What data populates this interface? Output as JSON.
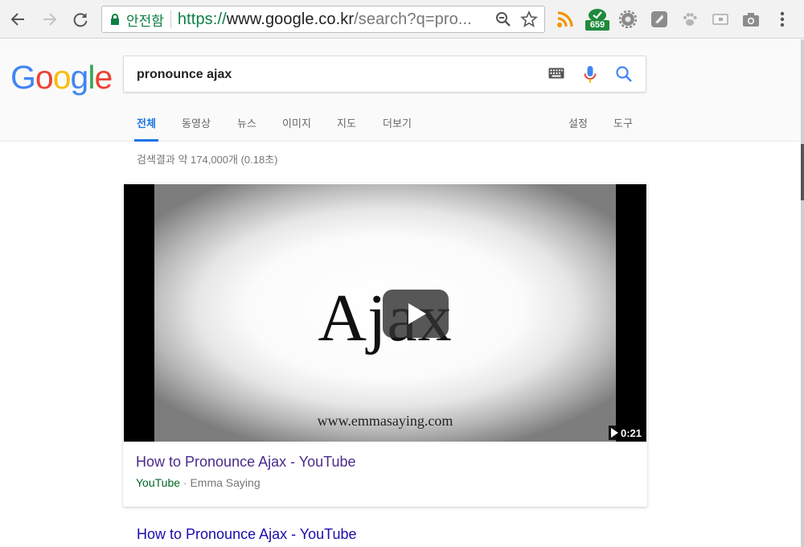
{
  "browser": {
    "security_label": "안전함",
    "url_scheme": "https://",
    "url_host": "www.google.co.kr",
    "url_rest": "/search?q=pro...",
    "extension_badge_count": "659",
    "icons": [
      "back-arrow-icon",
      "forward-arrow-icon",
      "reload-icon",
      "lock-icon",
      "zoom-icon",
      "star-icon",
      "rss-icon",
      "gear-icon",
      "shield-icon",
      "paw-icon",
      "box-icon",
      "camera-icon",
      "menu-dots-icon"
    ]
  },
  "google": {
    "logo": {
      "letters": [
        "G",
        "o",
        "o",
        "g",
        "l",
        "e"
      ],
      "colors": [
        "#4285F4",
        "#EA4335",
        "#FBBC05",
        "#4285F4",
        "#34A853",
        "#EA4335"
      ]
    },
    "search": {
      "query": "pronounce ajax"
    },
    "tabs": [
      {
        "label": "전체",
        "active": true
      },
      {
        "label": "동영상"
      },
      {
        "label": "뉴스"
      },
      {
        "label": "이미지"
      },
      {
        "label": "지도"
      },
      {
        "label": "더보기"
      },
      {
        "label": "설정"
      },
      {
        "label": "도구"
      }
    ]
  },
  "results": {
    "stats": "검색결과 약 174,000개 (0.18초)",
    "video": {
      "thumbnail_word": "Ajax",
      "thumbnail_site": "www.emmasaying.com",
      "duration": "0:21",
      "title": "How to Pronounce Ajax - YouTube",
      "source": "YouTube",
      "separator": "·",
      "author": "Emma Saying"
    },
    "second": {
      "title": "How to Pronounce Ajax - YouTube"
    }
  },
  "colors": {
    "accent": "#1a73e8",
    "visited_link": "#4a2b8b",
    "link": "#1a0dab",
    "url_green": "#006621",
    "secure_green": "#0b8043"
  }
}
